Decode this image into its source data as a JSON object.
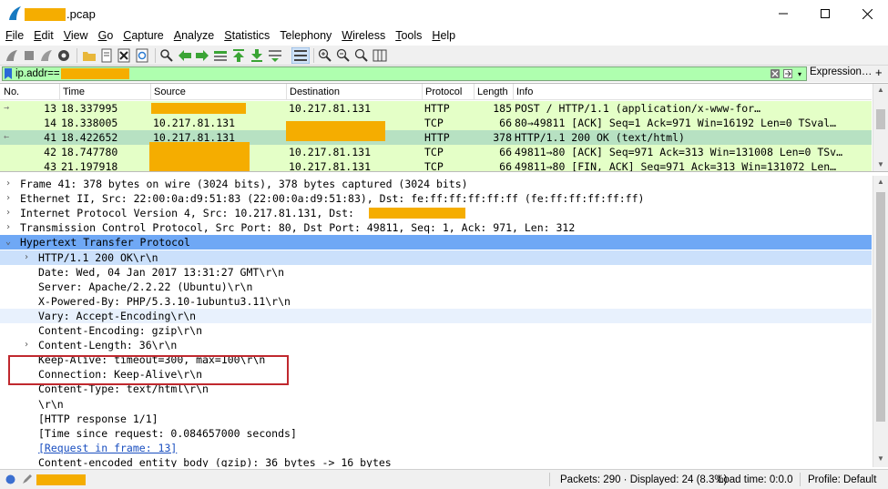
{
  "window": {
    "title_suffix": ".pcap",
    "controls": [
      "minimize",
      "maximize",
      "close"
    ]
  },
  "menu": [
    {
      "label": "File",
      "key": "F",
      "rest": "ile"
    },
    {
      "label": "Edit",
      "key": "E",
      "rest": "dit"
    },
    {
      "label": "View",
      "key": "V",
      "rest": "iew"
    },
    {
      "label": "Go",
      "key": "G",
      "rest": "o"
    },
    {
      "label": "Capture",
      "key": "C",
      "rest": "apture"
    },
    {
      "label": "Analyze",
      "key": "A",
      "rest": "nalyze"
    },
    {
      "label": "Statistics",
      "key": "S",
      "rest": "tatistics"
    },
    {
      "label": "Telephony",
      "key": "T",
      "rest": "elephony",
      "underline_index": 9
    },
    {
      "label": "Wireless",
      "key": "W",
      "rest": "ireless"
    },
    {
      "label": "Tools",
      "key": "T",
      "rest": "ools"
    },
    {
      "label": "Help",
      "key": "H",
      "rest": "elp"
    }
  ],
  "filter": {
    "value": "ip.addr==",
    "expression_label": "Expression…",
    "plus_label": "+"
  },
  "packet_list": {
    "columns": [
      "No.",
      "Time",
      "Source",
      "Destination",
      "Protocol",
      "Length",
      "Info"
    ],
    "rows": [
      {
        "no": "13",
        "time": "18.337995",
        "source": "",
        "destination": "10.217.81.131",
        "protocol": "HTTP",
        "length": "185",
        "info": "POST /            HTTP/1.1  (application/x-www-for…",
        "bg": "#e4ffc7",
        "marker": "→"
      },
      {
        "no": "14",
        "time": "18.338005",
        "source": "10.217.81.131",
        "destination": "",
        "protocol": "TCP",
        "length": "66",
        "info": "80→49811 [ACK] Seq=1 Ack=971 Win=16192 Len=0 TSval…",
        "bg": "#e4ffc7",
        "marker": ""
      },
      {
        "no": "41",
        "time": "18.422652",
        "source": "10.217.81.131",
        "destination": "",
        "protocol": "HTTP",
        "length": "378",
        "info": "HTTP/1.1 200 OK  (text/html)",
        "bg": "#b7e1c2",
        "marker": "←"
      },
      {
        "no": "42",
        "time": "18.747780",
        "source": "",
        "destination": "10.217.81.131",
        "protocol": "TCP",
        "length": "66",
        "info": "49811→80 [ACK] Seq=971 Ack=313 Win=131008 Len=0 TSv…",
        "bg": "#e4ffc7",
        "marker": ""
      },
      {
        "no": "43",
        "time": "21.197918",
        "source": "",
        "destination": "10.217.81.131",
        "protocol": "TCP",
        "length": "66",
        "info": "49811→80 [FIN, ACK] Seq=971 Ack=313 Win=131072 Len…",
        "bg": "#e4ffc7",
        "marker": ""
      }
    ]
  },
  "details": [
    {
      "indent": 0,
      "twisty": "›",
      "text": "Frame 41: 378 bytes on wire (3024 bits), 378 bytes captured (3024 bits)"
    },
    {
      "indent": 0,
      "twisty": "›",
      "text": "Ethernet II, Src: 22:00:0a:d9:51:83 (22:00:0a:d9:51:83), Dst: fe:ff:ff:ff:ff:ff (fe:ff:ff:ff:ff:ff)"
    },
    {
      "indent": 0,
      "twisty": "›",
      "text": "Internet Protocol Version 4, Src: 10.217.81.131, Dst:"
    },
    {
      "indent": 0,
      "twisty": "›",
      "text": "Transmission Control Protocol, Src Port: 80, Dst Port: 49811, Seq: 1, Ack: 971, Len: 312"
    },
    {
      "indent": 0,
      "twisty": "⌄",
      "text": "Hypertext Transfer Protocol",
      "bg": "#6fa8f5"
    },
    {
      "indent": 1,
      "twisty": "›",
      "text": "HTTP/1.1 200 OK\\r\\n",
      "bg": "#cbe0fb"
    },
    {
      "indent": 1,
      "twisty": "",
      "text": "Date: Wed, 04 Jan 2017 13:31:27 GMT\\r\\n"
    },
    {
      "indent": 1,
      "twisty": "",
      "text": "Server: Apache/2.2.22 (Ubuntu)\\r\\n"
    },
    {
      "indent": 1,
      "twisty": "",
      "text": "X-Powered-By: PHP/5.3.10-1ubuntu3.11\\r\\n"
    },
    {
      "indent": 1,
      "twisty": "",
      "text": "Vary: Accept-Encoding\\r\\n",
      "bg": "#e8f1fd"
    },
    {
      "indent": 1,
      "twisty": "",
      "text": "Content-Encoding: gzip\\r\\n"
    },
    {
      "indent": 1,
      "twisty": "›",
      "text": "Content-Length: 36\\r\\n"
    },
    {
      "indent": 1,
      "twisty": "",
      "text": "Keep-Alive: timeout=300, max=100\\r\\n"
    },
    {
      "indent": 1,
      "twisty": "",
      "text": "Connection: Keep-Alive\\r\\n"
    },
    {
      "indent": 1,
      "twisty": "",
      "text": "Content-Type: text/html\\r\\n"
    },
    {
      "indent": 1,
      "twisty": "",
      "text": "\\r\\n"
    },
    {
      "indent": 1,
      "twisty": "",
      "text": "[HTTP response 1/1]"
    },
    {
      "indent": 1,
      "twisty": "",
      "text": "[Time since request: 0.084657000 seconds]"
    },
    {
      "indent": 1,
      "twisty": "",
      "text": "[Request in frame: 13]",
      "link": true
    },
    {
      "indent": 1,
      "twisty": "",
      "text": "Content-encoded entity body (gzip): 36 bytes -> 16 bytes"
    }
  ],
  "status": {
    "packets": "Packets: 290 · Displayed: 24 (8.3%)",
    "load_time": "Load time: 0:0.0",
    "profile": "Profile: Default"
  },
  "colors": {
    "redaction": "#f5ad00",
    "filter_valid": "#afffaf",
    "http_row": "#e4ffc7",
    "selected_row": "#b7e1c2",
    "tree_selected": "#6fa8f5",
    "highlight_box": "#c0282e"
  }
}
